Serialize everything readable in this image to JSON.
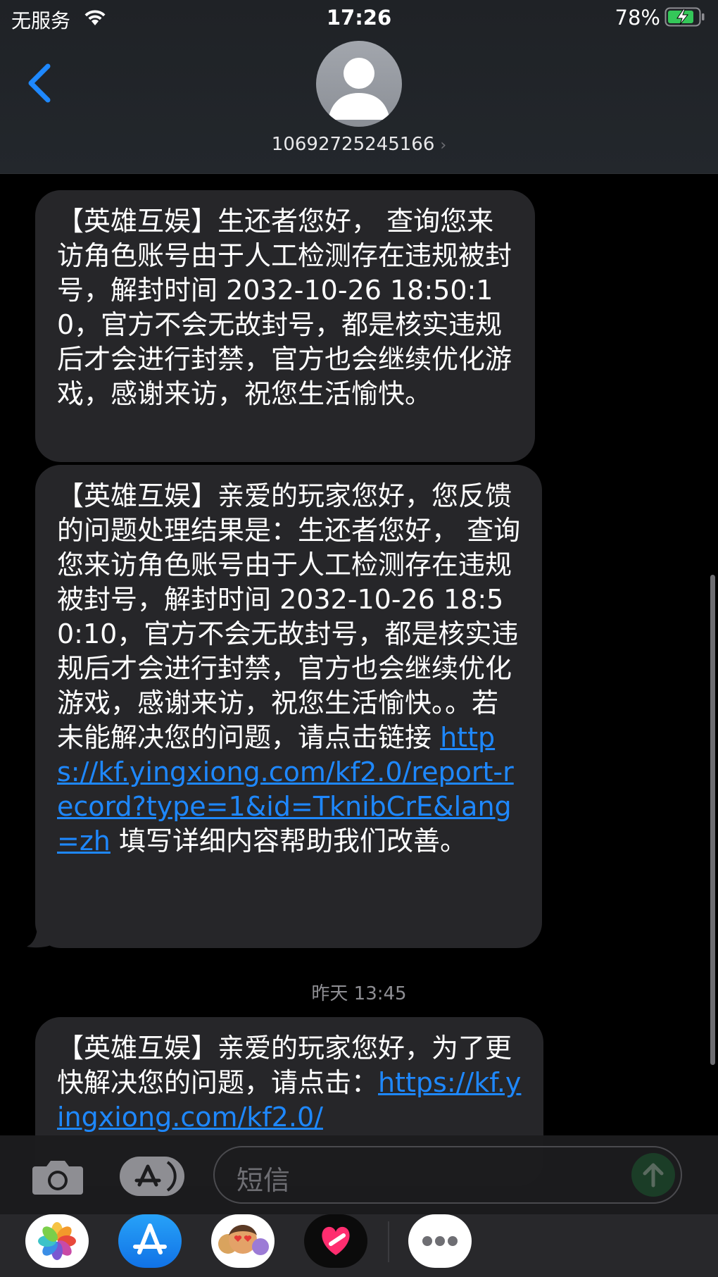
{
  "status_bar": {
    "carrier": "无服务",
    "time": "17:26",
    "battery": "78%"
  },
  "conversation": {
    "contact": "10692725245166",
    "contact_chevron": "›"
  },
  "messages": [
    {
      "text": "【英雄互娱】生还者您好， 查询您来访角色账号由于人工检测存在违规被封号，解封时间 2032-10-26 18:50:10，官方不会无故封号，都是核实违规后才会进行封禁，官方也会继续优化游戏，感谢来访，祝您生活愉快。"
    },
    {
      "text_before_link": "【英雄互娱】亲爱的玩家您好，您反馈的问题处理结果是：生还者您好， 查询您来访角色账号由于人工检测存在违规被封号，解封时间 2032-10-26 18:50:10，官方不会无故封号，都是核实违规后才会进行封禁，官方也会继续优化游戏，感谢来访，祝您生活愉快。。若未能解决您的问题，请点击链接 ",
      "link": "https://kf.yingxiong.com/kf2.0/report-record?type=1&id=TknibCrE&lang=zh",
      "text_after_link": " 填写详细内容帮助我们改善。"
    },
    {
      "text_before_link": "【英雄互娱】亲爱的玩家您好，为了更快解决您的问题，请点击：",
      "link": "https://kf.yingxiong.com/kf2.0/"
    }
  ],
  "timestamp": "昨天 13:45",
  "composer": {
    "placeholder": "短信"
  },
  "icons": [
    "back-chevron-icon",
    "wifi-icon",
    "battery-charging-icon",
    "camera-icon",
    "app-store-icon",
    "send-arrow-icon",
    "photos-icon",
    "memoji-icon",
    "digital-touch-icon",
    "more-icon"
  ],
  "colors": {
    "link": "#1e88ff",
    "accent": "#1e88ff",
    "bubble": "#262629",
    "battery": "#34c759"
  }
}
